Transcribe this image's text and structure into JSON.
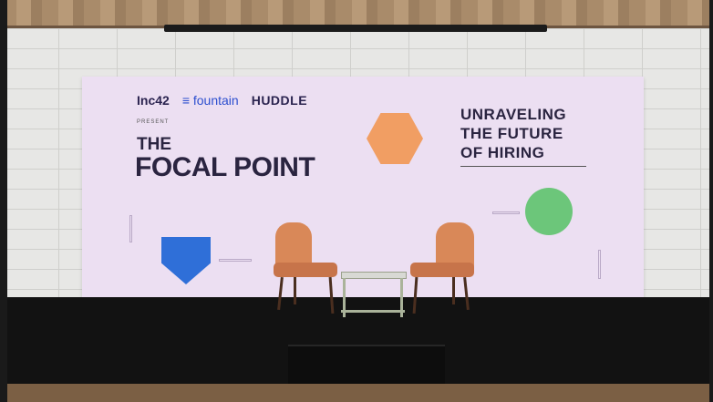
{
  "banner": {
    "sponsors": {
      "inc42": "Inc42",
      "fountain": "fountain",
      "huddle": "HUDDLE"
    },
    "present_label": "PRESENT",
    "title_line1": "THE",
    "title_line2": "FOCAL POINT",
    "headline": [
      "UNRAVELING",
      "THE FUTURE",
      "OF HIRING"
    ]
  },
  "colors": {
    "banner_bg": "#ecdff2",
    "hexagon": "#f19e63",
    "circle": "#6cc67a",
    "pentagon": "#2f6fd8",
    "chair": "#d98858",
    "stage": "#121212"
  }
}
